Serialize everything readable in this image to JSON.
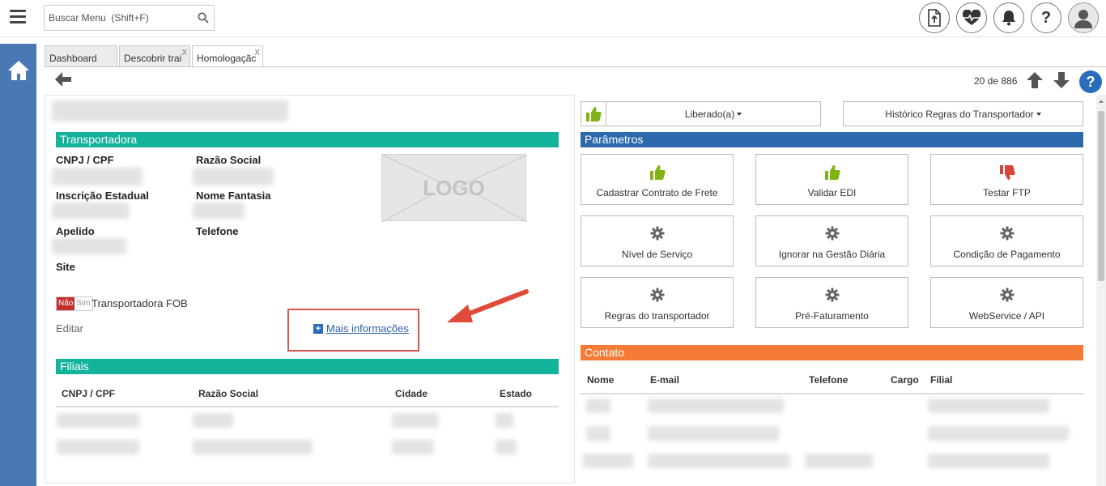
{
  "search": {
    "placeholder": "Buscar Menu  (Shift+F)"
  },
  "topbar_icons": [
    "upload-file-icon",
    "heartbeat-icon",
    "bell-icon",
    "help-icon",
    "user-avatar-icon"
  ],
  "tabs": [
    {
      "label": "Dashboard",
      "closable": false,
      "active": false
    },
    {
      "label": "Descobrir trai",
      "closable": true,
      "active": false
    },
    {
      "label": "Homologaçãc",
      "closable": true,
      "active": true
    }
  ],
  "tab_close": "X",
  "pagination": {
    "counter": "20 de 886"
  },
  "help_label": "?",
  "transportadora": {
    "title": "Transportadora",
    "fields": {
      "cnpj": "CNPJ / CPF",
      "razao_social": "Razão Social",
      "inscricao": "Inscrição Estadual",
      "nome_fantasia": "Nome Fantasia",
      "apelido": "Apelido",
      "telefone": "Telefone",
      "site": "Site"
    },
    "logo_text": "LOGO",
    "toggle": {
      "no": "Não",
      "yes": "Sim"
    },
    "fob_label": "Transportadora FOB",
    "edit_label": "Editar",
    "more_info": "Mais informações"
  },
  "filiais": {
    "title": "Filiais",
    "columns": [
      "CNPJ / CPF",
      "Razão Social",
      "Cidade",
      "Estado"
    ]
  },
  "right": {
    "status_button": "Liberado(a)",
    "history_button": "Histórico Regras do Transportador",
    "parametros_title": "Parâmetros",
    "cards": [
      {
        "label": "Cadastrar Contrato de Frete",
        "icon": "thumbs-up-icon"
      },
      {
        "label": "Validar EDI",
        "icon": "thumbs-up-icon"
      },
      {
        "label": "Testar FTP",
        "icon": "thumbs-down-icon"
      },
      {
        "label": "Nível de Serviço",
        "icon": "gear-icon"
      },
      {
        "label": "Ignorar na Gestão Diária",
        "icon": "gear-icon"
      },
      {
        "label": "Condição de Pagamento",
        "icon": "gear-icon"
      },
      {
        "label": "Regras do transportador",
        "icon": "gear-icon"
      },
      {
        "label": "Pré-Faturamento",
        "icon": "gear-icon"
      },
      {
        "label": "WebService / API",
        "icon": "gear-icon"
      }
    ],
    "contato_title": "Contato",
    "contato_columns": [
      "Nome",
      "E-mail",
      "Telefone",
      "Cargo",
      "Filial"
    ]
  },
  "colors": {
    "teal": "#13b29b",
    "blue": "#2c6aad",
    "orange": "#f47a35",
    "sidebar": "#4a78b5",
    "thumb_up": "#7fb414",
    "thumb_down": "#d9443c",
    "highlight": "#d9534f"
  }
}
